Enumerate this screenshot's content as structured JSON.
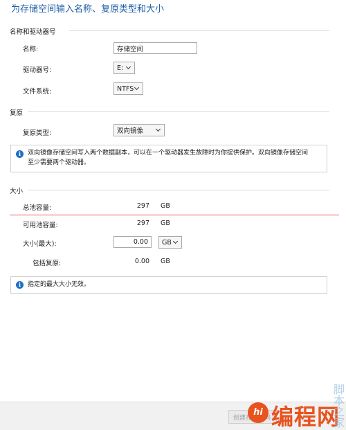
{
  "page": {
    "title": "为存储空间输入名称、复原类型和大小"
  },
  "name_section": {
    "heading": "名称和驱动器号",
    "name_label": "名称:",
    "name_value": "存储空间",
    "drive_label": "驱动器号:",
    "drive_value": "E:",
    "fs_label": "文件系统:",
    "fs_value": "NTFS"
  },
  "resiliency_section": {
    "heading": "复原",
    "type_label": "复原类型:",
    "type_value": "双向镜像",
    "info_line1": "双向镜像存储空间写入两个数据副本，可以在一个驱动器发生故障时为你提供保护。双向镜像存储空间",
    "info_line2": "至少需要两个驱动器。"
  },
  "size_section": {
    "heading": "大小",
    "total_label": "总池容量:",
    "total_value": "297",
    "total_unit": "GB",
    "available_label": "可用池容量:",
    "available_value": "297",
    "available_unit": "GB",
    "max_label": "大小(最大):",
    "max_value": "0.00",
    "max_unit": "GB",
    "incl_label": "包括复原:",
    "incl_value": "0.00",
    "incl_unit": "GB",
    "warning": "指定的最大大小无效。"
  },
  "footer": {
    "create_label": "创建存储空间"
  },
  "watermark": {
    "logo": "hi",
    "text": "编程网",
    "side": "脚本之家"
  },
  "colors": {
    "title_blue": "#1f5fa8",
    "info_blue": "#1f6fc4",
    "watermark_orange": "#e8531f",
    "red_line": "#e05a4a"
  },
  "icons": {
    "info": "info-circle-icon",
    "dropdown": "chevron-down-icon"
  }
}
